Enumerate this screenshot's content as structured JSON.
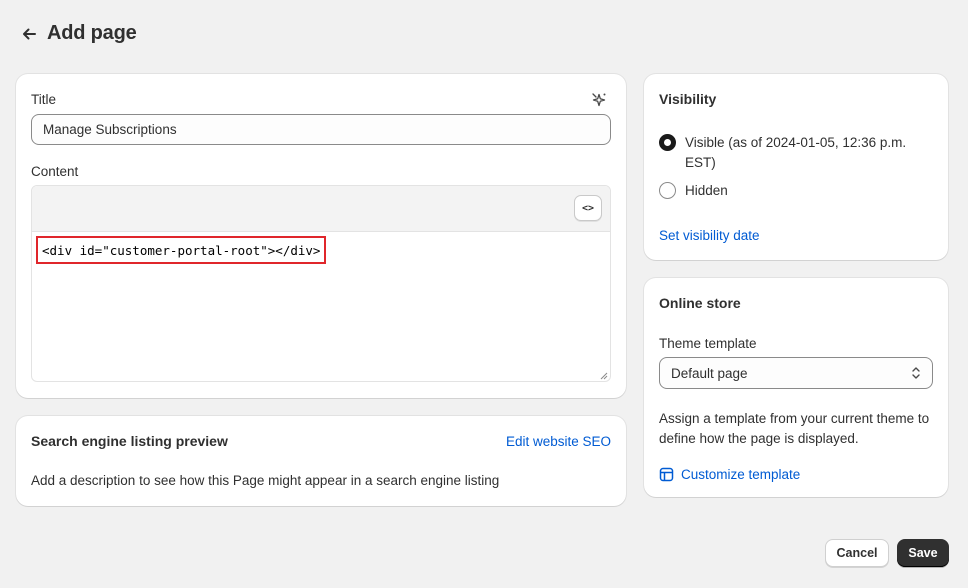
{
  "header": {
    "title": "Add page"
  },
  "main": {
    "title_label": "Title",
    "title_value": "Manage Subscriptions",
    "content_label": "Content",
    "html_toggle_label": "<>",
    "code": "<div id=\"customer-portal-root\"></div>"
  },
  "seo": {
    "title": "Search engine listing preview",
    "edit_link": "Edit website SEO",
    "description": "Add a description to see how this Page might appear in a search engine listing"
  },
  "visibility": {
    "title": "Visibility",
    "options": [
      {
        "label": "Visible (as of 2024-01-05, 12:36 p.m. EST)",
        "checked": true
      },
      {
        "label": "Hidden",
        "checked": false
      }
    ],
    "set_date_link": "Set visibility date"
  },
  "online_store": {
    "title": "Online store",
    "theme_label": "Theme template",
    "theme_value": "Default page",
    "description": "Assign a template from your current theme to define how the page is displayed.",
    "customize_link": "Customize template"
  },
  "footer": {
    "cancel_label": "Cancel",
    "save_label": "Save"
  },
  "colors": {
    "link": "#005bd3",
    "primary_button": "#303030",
    "highlight_border": "#e0262b",
    "background": "#f1f1f1"
  }
}
